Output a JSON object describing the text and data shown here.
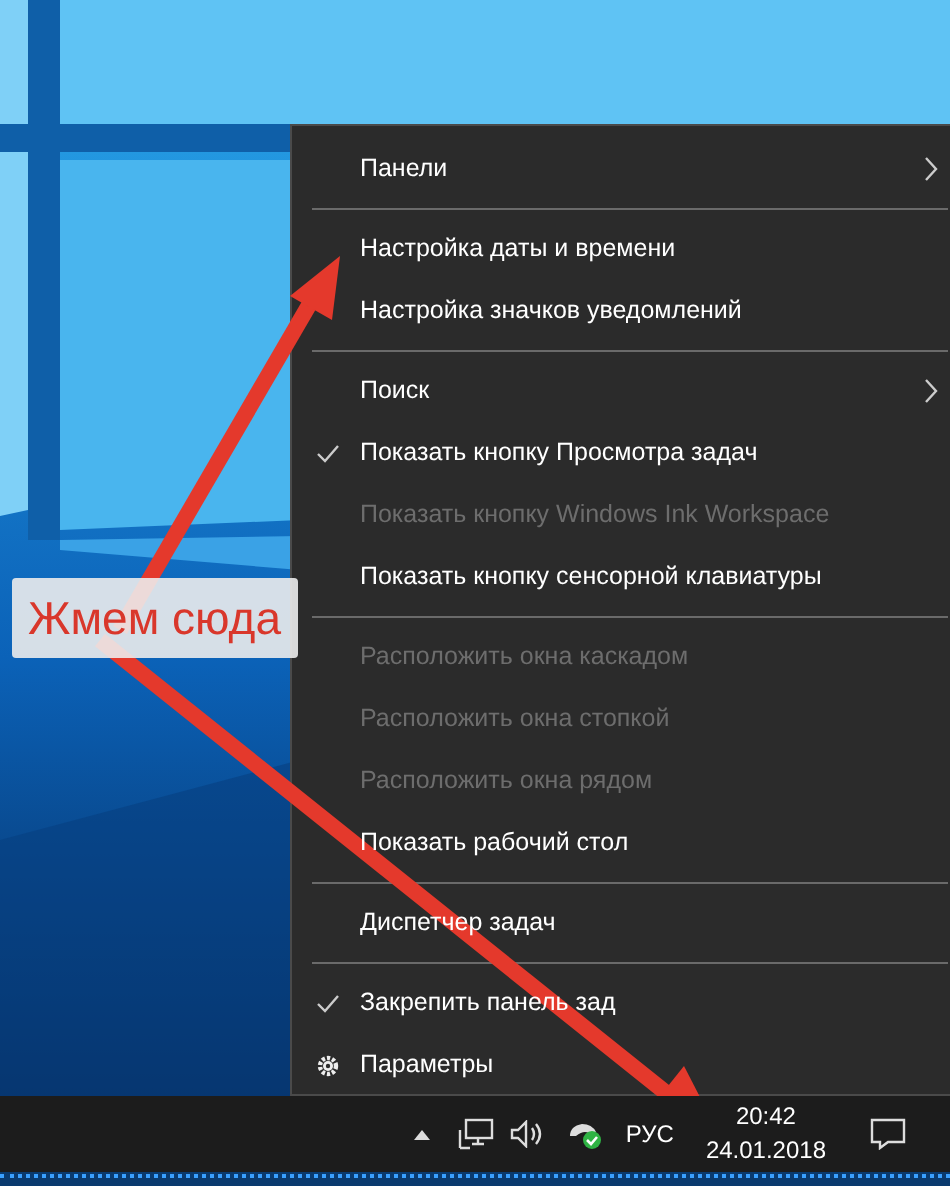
{
  "context_menu": {
    "items": [
      {
        "kind": "item",
        "label": "Панели",
        "checked": false,
        "disabled": false,
        "submenu": true
      },
      {
        "kind": "separator"
      },
      {
        "kind": "item",
        "label": "Настройка даты и времени",
        "checked": false,
        "disabled": false,
        "submenu": false
      },
      {
        "kind": "item",
        "label": "Настройка значков уведомлений",
        "checked": false,
        "disabled": false,
        "submenu": false
      },
      {
        "kind": "separator"
      },
      {
        "kind": "item",
        "label": "Поиск",
        "checked": false,
        "disabled": false,
        "submenu": true
      },
      {
        "kind": "item",
        "label": "Показать кнопку Просмотра задач",
        "checked": true,
        "disabled": false,
        "submenu": false
      },
      {
        "kind": "item",
        "label": "Показать кнопку Windows Ink Workspace",
        "checked": false,
        "disabled": true,
        "submenu": false
      },
      {
        "kind": "item",
        "label": "Показать кнопку сенсорной клавиатуры",
        "checked": false,
        "disabled": false,
        "submenu": false
      },
      {
        "kind": "separator"
      },
      {
        "kind": "item",
        "label": "Расположить окна каскадом",
        "checked": false,
        "disabled": true,
        "submenu": false
      },
      {
        "kind": "item",
        "label": "Расположить окна стопкой",
        "checked": false,
        "disabled": true,
        "submenu": false
      },
      {
        "kind": "item",
        "label": "Расположить окна рядом",
        "checked": false,
        "disabled": true,
        "submenu": false
      },
      {
        "kind": "item",
        "label": "Показать рабочий стол",
        "checked": false,
        "disabled": false,
        "submenu": false
      },
      {
        "kind": "separator"
      },
      {
        "kind": "item",
        "label": "Диспетчер задач",
        "checked": false,
        "disabled": false,
        "submenu": false
      },
      {
        "kind": "separator"
      },
      {
        "kind": "item",
        "label": "Закрепить панель зад",
        "checked": true,
        "disabled": false,
        "submenu": false
      },
      {
        "kind": "settings",
        "label": "Параметры",
        "checked": false,
        "disabled": false,
        "submenu": false
      }
    ]
  },
  "annotation": {
    "text": "Жмем сюда"
  },
  "taskbar": {
    "language": "РУС",
    "time": "20:42",
    "date": "24.01.2018"
  }
}
